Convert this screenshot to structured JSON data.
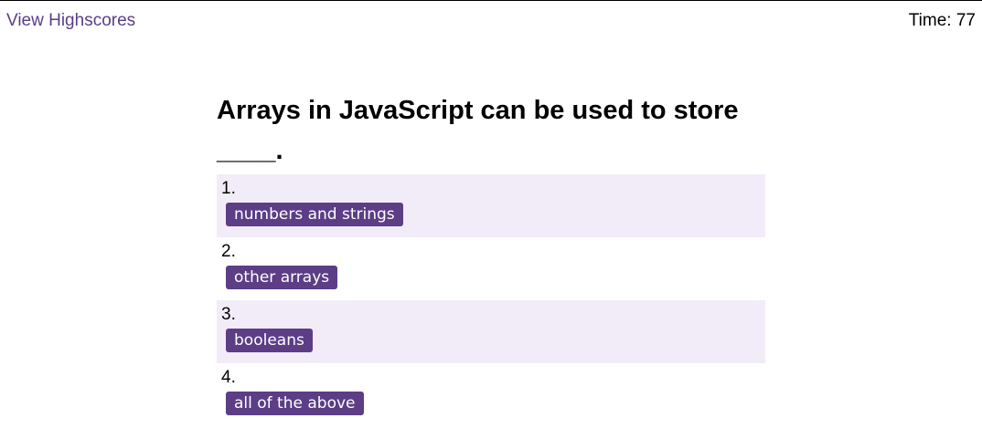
{
  "header": {
    "highscores_link": "View Highscores",
    "timer": "Time: 77"
  },
  "question": {
    "text": "Arrays in JavaScript can be used to store ____."
  },
  "choices": [
    {
      "number": "1.",
      "label": "numbers and strings"
    },
    {
      "number": "2.",
      "label": "other arrays"
    },
    {
      "number": "3.",
      "label": "booleans"
    },
    {
      "number": "4.",
      "label": "all of the above"
    }
  ],
  "colors": {
    "accent": "#5c3d86",
    "link": "#5a3d8a",
    "row_highlight": "#f2ecf9"
  }
}
